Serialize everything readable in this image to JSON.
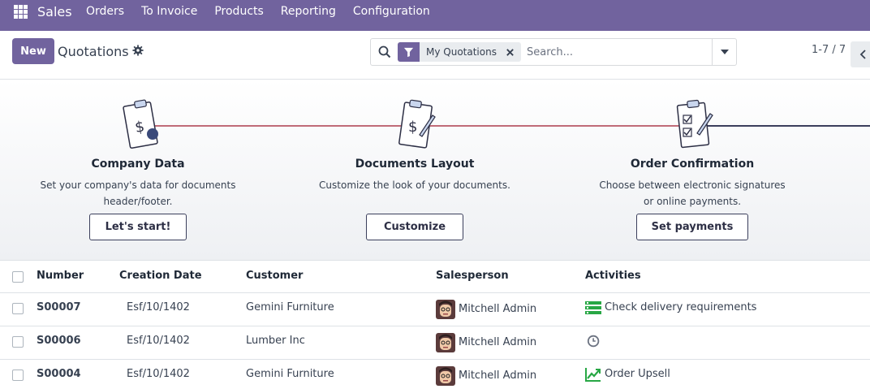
{
  "navbar": {
    "apps_icon": "apps-grid-icon",
    "brand": "Sales",
    "menu": [
      "Orders",
      "To Invoice",
      "Products",
      "Reporting",
      "Configuration"
    ]
  },
  "control": {
    "new_label": "New",
    "title": "Quotations",
    "search": {
      "facet_label": "My Quotations",
      "placeholder": "Search..."
    },
    "pager": "1-7 / 7"
  },
  "onboarding": {
    "steps": [
      {
        "title": "Company Data",
        "desc_line1": "Set your company's data for documents",
        "desc_line2": "header/footer.",
        "button": "Let's start!"
      },
      {
        "title": "Documents Layout",
        "desc_line1": "Customize the look of your documents.",
        "desc_line2": "",
        "button": "Customize"
      },
      {
        "title": "Order Confirmation",
        "desc_line1": "Choose between electronic signatures",
        "desc_line2": "or online payments.",
        "button": "Set payments"
      }
    ]
  },
  "table": {
    "headers": {
      "number": "Number",
      "date": "Creation Date",
      "customer": "Customer",
      "salesperson": "Salesperson",
      "activities": "Activities"
    },
    "rows": [
      {
        "number": "S00007",
        "date": "Esf/10/1402",
        "customer": "Gemini Furniture",
        "salesperson": "Mitchell Admin",
        "activity": "Check delivery requirements",
        "activity_icon": "todo-list-icon"
      },
      {
        "number": "S00006",
        "date": "Esf/10/1402",
        "customer": "Lumber Inc",
        "salesperson": "Mitchell Admin",
        "activity": "",
        "activity_icon": "clock-icon"
      },
      {
        "number": "S00004",
        "date": "Esf/10/1402",
        "customer": "Gemini Furniture",
        "salesperson": "Mitchell Admin",
        "activity": "Order Upsell",
        "activity_icon": "trend-up-icon"
      }
    ]
  },
  "colors": {
    "brand": "#71639e",
    "activity_green": "#28a745",
    "line_red": "#c06c78",
    "line_dark": "#3b3f5c"
  }
}
